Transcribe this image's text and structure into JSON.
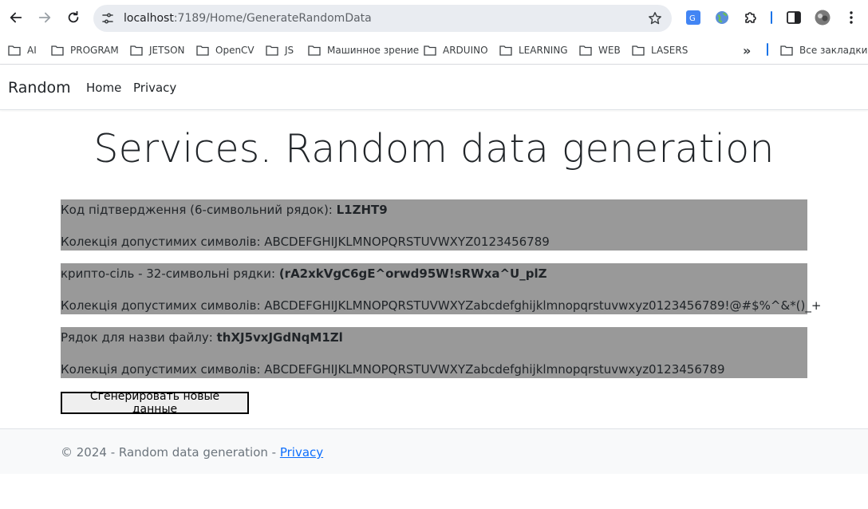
{
  "browser": {
    "url_host": "localhost",
    "url_path": ":7189/Home/GenerateRandomData",
    "bookmarks": [
      "AI",
      "PROGRAM",
      "JETSON",
      "OpenCV",
      "JS",
      "Машинное зрение",
      "ARDUINO",
      "LEARNING",
      "WEB",
      "LASERS"
    ],
    "overflow_label": "»",
    "all_bookmarks_label": "Все закладки"
  },
  "header": {
    "brand": "Random",
    "nav": [
      "Home",
      "Privacy"
    ]
  },
  "main": {
    "title": "Services. Random data generation",
    "blocks": [
      {
        "label": "Код підтвердження (6-символьний рядок): ",
        "value": "L1ZHT9",
        "charset_label": "Колекція допустимих символів: ",
        "charset": "ABCDEFGHIJKLMNOPQRSTUVWXYZ0123456789"
      },
      {
        "label": "крипто-сіль - 32-символьні рядки: ",
        "value": "(rA2xkVgC6gE^orwd95W!sRWxa^U_plZ",
        "charset_label": "Колекція допустимих символів: ",
        "charset": "ABCDEFGHIJKLMNOPQRSTUVWXYZabcdefghijklmnopqrstuvwxyz0123456789!@#$%^&*()_+"
      },
      {
        "label": "Рядок для назви файлу: ",
        "value": "thXJ5vxJGdNqM1Zl",
        "charset_label": "Колекція допустимих символів: ",
        "charset": "ABCDEFGHIJKLMNOPQRSTUVWXYZabcdefghijklmnopqrstuvwxyz0123456789"
      }
    ],
    "generate_button": "Сгенерировать новые данные"
  },
  "footer": {
    "text": "© 2024 - Random data generation - ",
    "privacy_link": "Privacy"
  },
  "colors": {
    "block_bg": "#999999",
    "link": "#0d6efd",
    "footer_bg": "#f8f9fa"
  }
}
